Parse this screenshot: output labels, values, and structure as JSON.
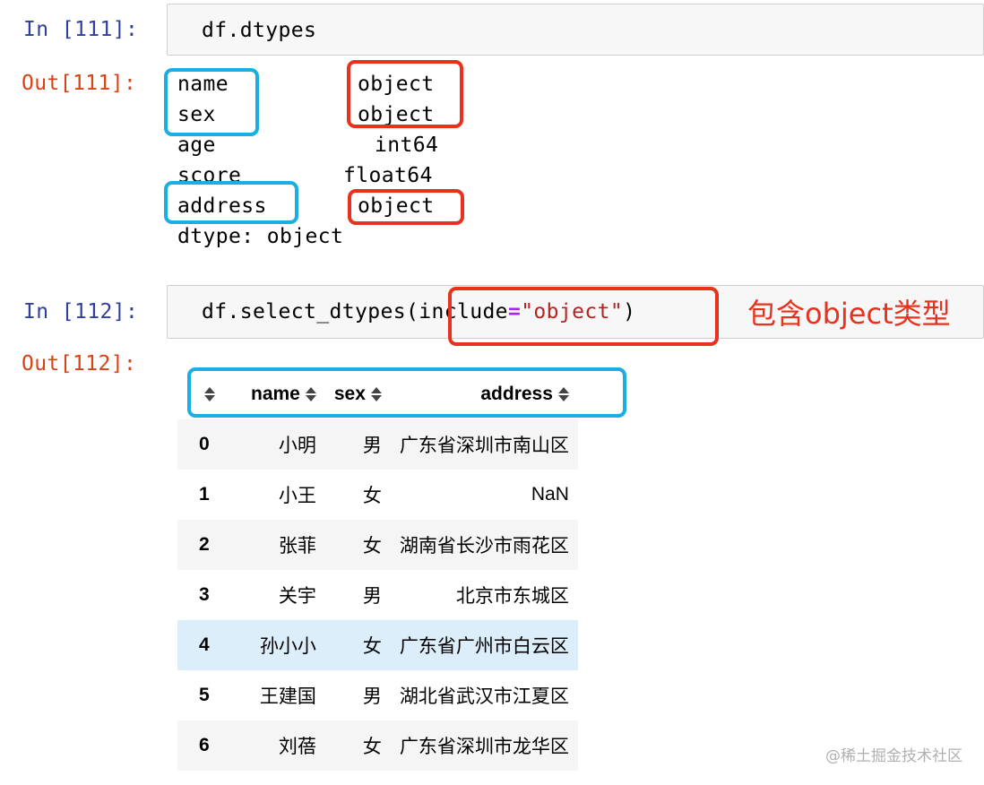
{
  "cells": [
    {
      "in_prompt": "In [111]:",
      "code": "df.dtypes",
      "out_prompt": "Out[111]:",
      "dtypes": [
        {
          "name": "name",
          "type": "object"
        },
        {
          "name": "sex",
          "type": "object"
        },
        {
          "name": "age",
          "type": "int64"
        },
        {
          "name": "score",
          "type": "float64"
        },
        {
          "name": "address",
          "type": "object"
        }
      ],
      "dtype_footer": "dtype: object"
    },
    {
      "in_prompt": "In [112]:",
      "code_func": "df.select_dtypes(",
      "code_kw": "include",
      "code_op": "=",
      "code_str": "\"object\"",
      "code_close": ")",
      "annotation": "包含object类型",
      "out_prompt": "Out[112]:"
    }
  ],
  "table": {
    "columns": [
      "",
      "name",
      "sex",
      "address"
    ],
    "rows": [
      {
        "index": "0",
        "name": "小明",
        "sex": "男",
        "address": "广东省深圳市南山区"
      },
      {
        "index": "1",
        "name": "小王",
        "sex": "女",
        "address": "NaN"
      },
      {
        "index": "2",
        "name": "张菲",
        "sex": "女",
        "address": "湖南省长沙市雨花区"
      },
      {
        "index": "3",
        "name": "关宇",
        "sex": "男",
        "address": "北京市东城区"
      },
      {
        "index": "4",
        "name": "孙小小",
        "sex": "女",
        "address": "广东省广州市白云区"
      },
      {
        "index": "5",
        "name": "王建国",
        "sex": "男",
        "address": "湖北省武汉市江夏区"
      },
      {
        "index": "6",
        "name": "刘蓓",
        "sex": "女",
        "address": "广东省深圳市龙华区"
      }
    ],
    "hovered_row": 4
  },
  "watermark": "@稀土掘金技术社区",
  "colors": {
    "in_prompt": "#303f9f",
    "out_prompt": "#d84315",
    "highlight_blue": "#1aaee5",
    "highlight_red": "#e8321d",
    "row_hover": "#dceefa"
  }
}
